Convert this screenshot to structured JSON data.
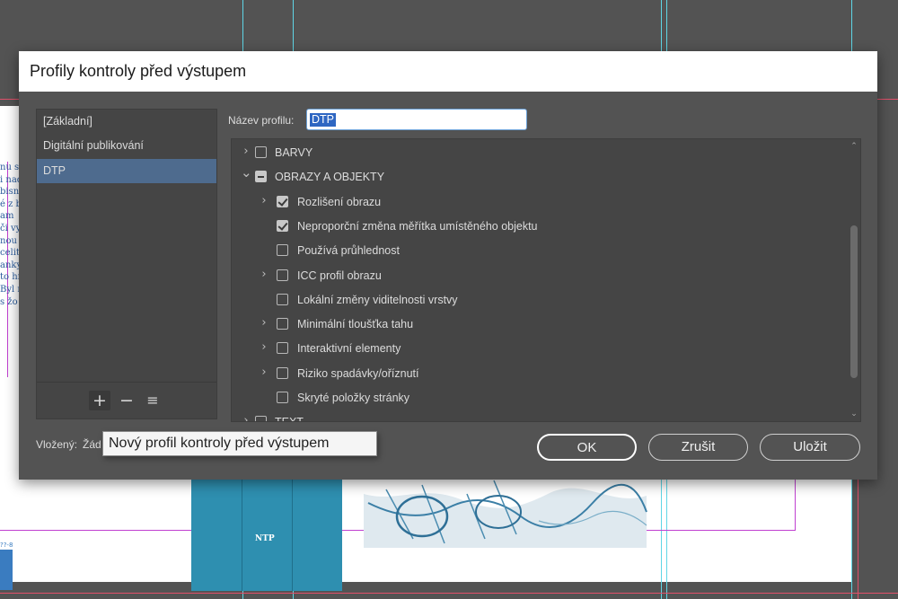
{
  "dialog": {
    "title": "Profily kontroly před výstupem",
    "profiles": [
      "[Základní]",
      "Digitální publikování",
      "DTP"
    ],
    "selected_profile": "DTP",
    "list_buttons": {
      "add": "+",
      "remove": "−",
      "menu": "≡"
    },
    "name_label": "Název profilu:",
    "name_value": "DTP",
    "tree": [
      {
        "label": "BARVY",
        "expander": "collapsed",
        "state": "unchecked"
      },
      {
        "label": "OBRAZY A OBJEKTY",
        "expander": "expanded",
        "state": "mixed"
      },
      {
        "label": "Rozlišení obrazu",
        "expander": "collapsed",
        "state": "checked"
      },
      {
        "label": "Neproporční změna měřítka umístěného objektu",
        "expander": "none",
        "state": "checked"
      },
      {
        "label": "Používá průhlednost",
        "expander": "none",
        "state": "unchecked"
      },
      {
        "label": "ICC profil obrazu",
        "expander": "collapsed",
        "state": "unchecked"
      },
      {
        "label": "Lokální změny viditelnosti vrstvy",
        "expander": "none",
        "state": "unchecked"
      },
      {
        "label": "Minimální tloušťka tahu",
        "expander": "collapsed",
        "state": "unchecked"
      },
      {
        "label": "Interaktivní elementy",
        "expander": "collapsed",
        "state": "unchecked"
      },
      {
        "label": "Riziko spadávky/oříznutí",
        "expander": "collapsed",
        "state": "unchecked"
      },
      {
        "label": "Skryté položky stránky",
        "expander": "none",
        "state": "unchecked"
      },
      {
        "label": "TEXT",
        "expander": "collapsed",
        "state": "unchecked"
      }
    ],
    "embedded_label": "Vložený:",
    "embedded_value": "Žád",
    "buttons": {
      "ok": "OK",
      "cancel": "Zrušit",
      "save": "Uložit"
    },
    "tooltip": "Nový profil kontroly před výstupem"
  },
  "background": {
    "text_fragments": [
      "nu s",
      "i nad",
      "bisn",
      "é z b",
      "am",
      "či vy",
      "nou",
      "celit",
      "anky",
      "to hr",
      "Byl n",
      "s žo"
    ],
    "block_label": "NTP",
    "small_label": "??-8"
  },
  "icons": {
    "expander_collapsed": "chevron-right-icon",
    "expander_expanded": "chevron-down-icon",
    "scroll_up": "scroll-up-arrow-icon",
    "scroll_down": "scroll-down-arrow-icon"
  },
  "colors": {
    "selected_row": "#4e6b8e",
    "input_focus": "#6aa0d8",
    "text_selection": "#2e66c2"
  }
}
